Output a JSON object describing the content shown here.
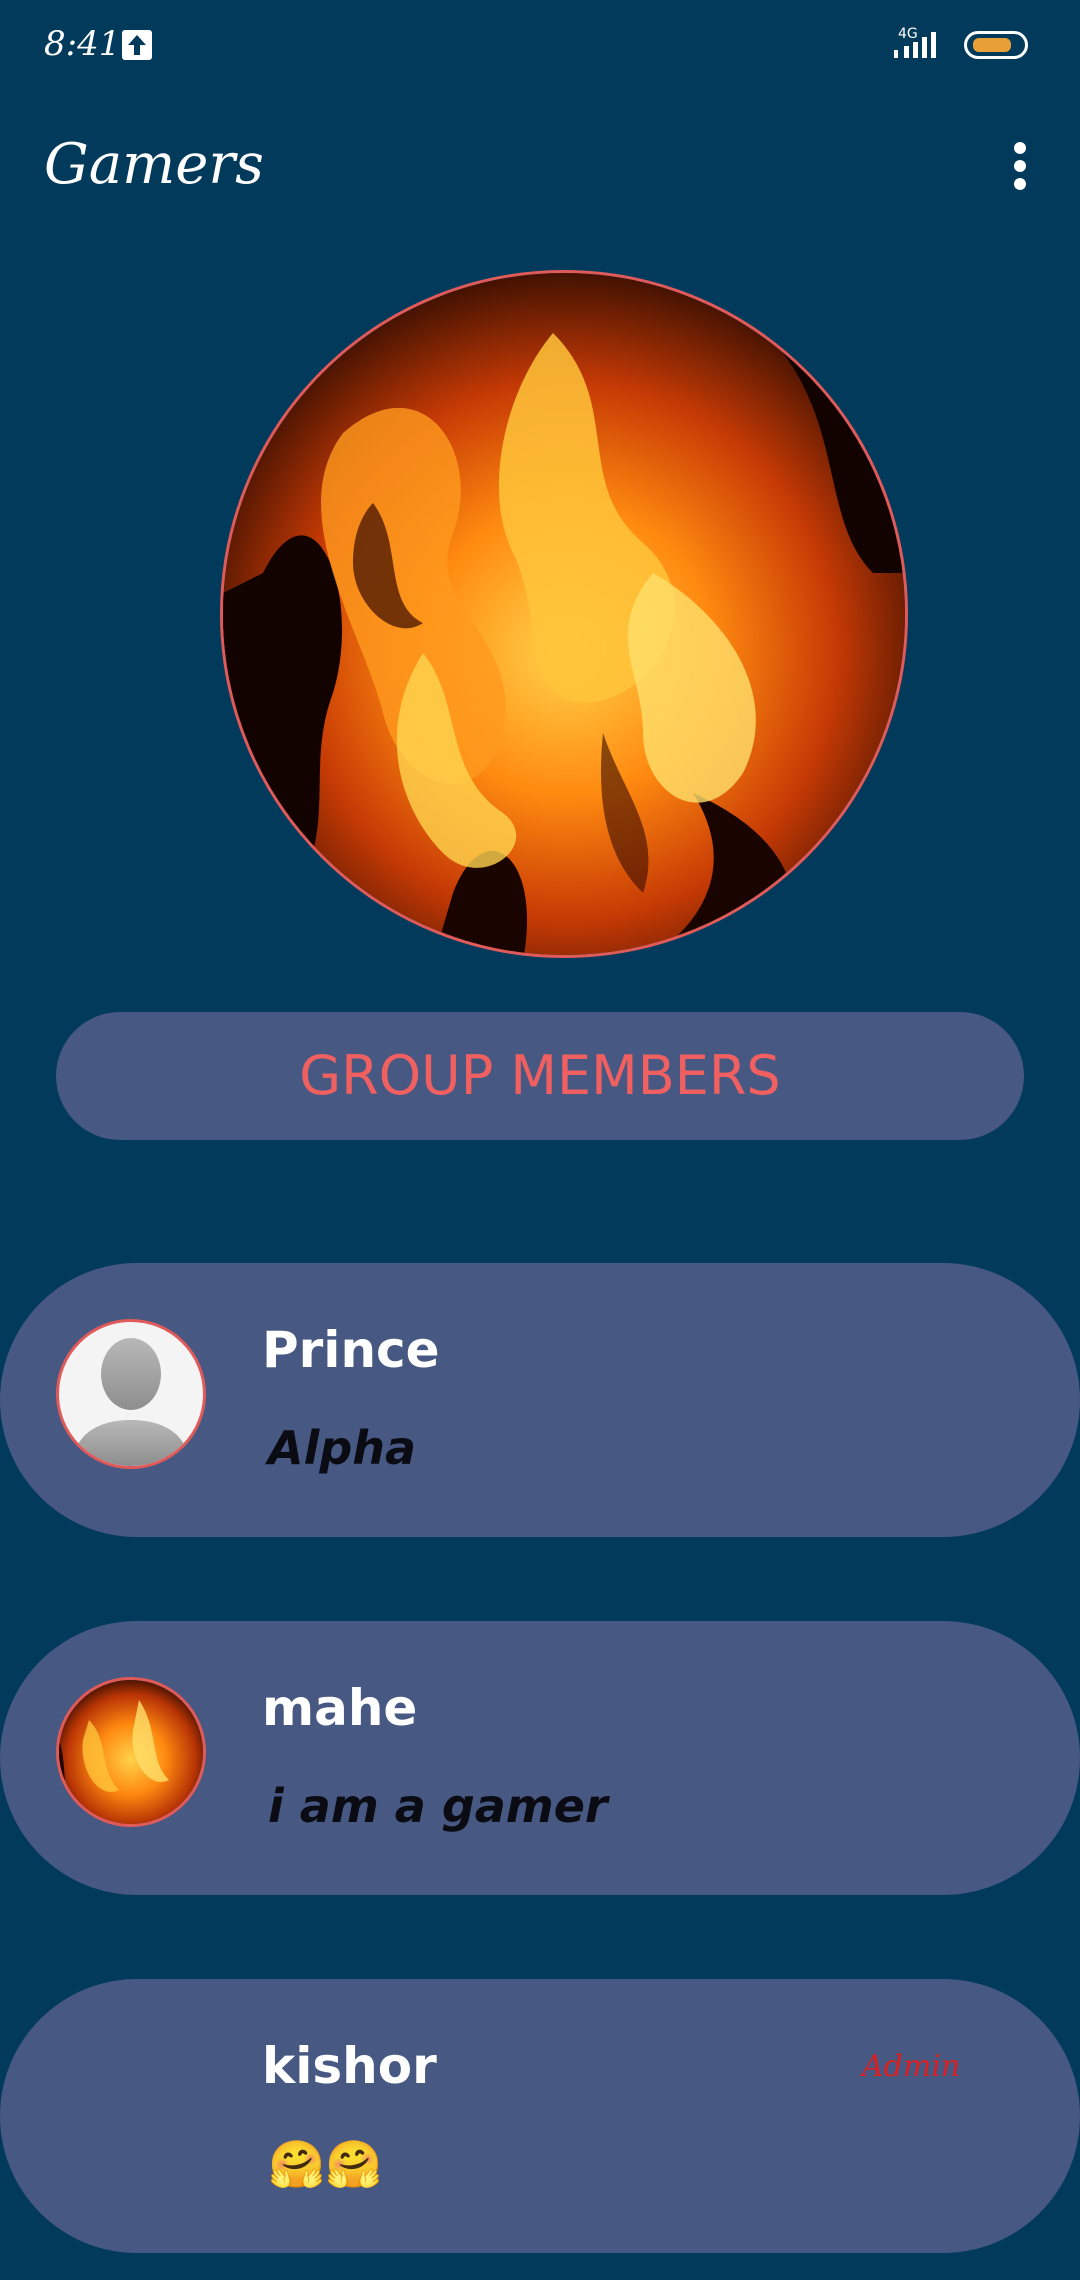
{
  "status_bar": {
    "time": "8:41",
    "network": "4G",
    "battery_color": "#e8a036"
  },
  "header": {
    "title": "Gamers",
    "menu_icon": "more-vert-icon"
  },
  "group_photo": "fire-image",
  "members_button": {
    "label": "GROUP MEMBERS",
    "color": "#f06060"
  },
  "members": [
    {
      "name": "Prince",
      "status": "Alpha",
      "avatar": "default-person-avatar",
      "badge": ""
    },
    {
      "name": "mahe",
      "status": "i am a gamer",
      "avatar": "fire-avatar",
      "badge": ""
    },
    {
      "name": "kishor",
      "status": "🤗🤗",
      "avatar": "",
      "badge": "Admin"
    }
  ],
  "colors": {
    "background": "#023a5b",
    "card": "#475882",
    "accent_border": "#e05a5a",
    "admin": "#d91f1f"
  }
}
